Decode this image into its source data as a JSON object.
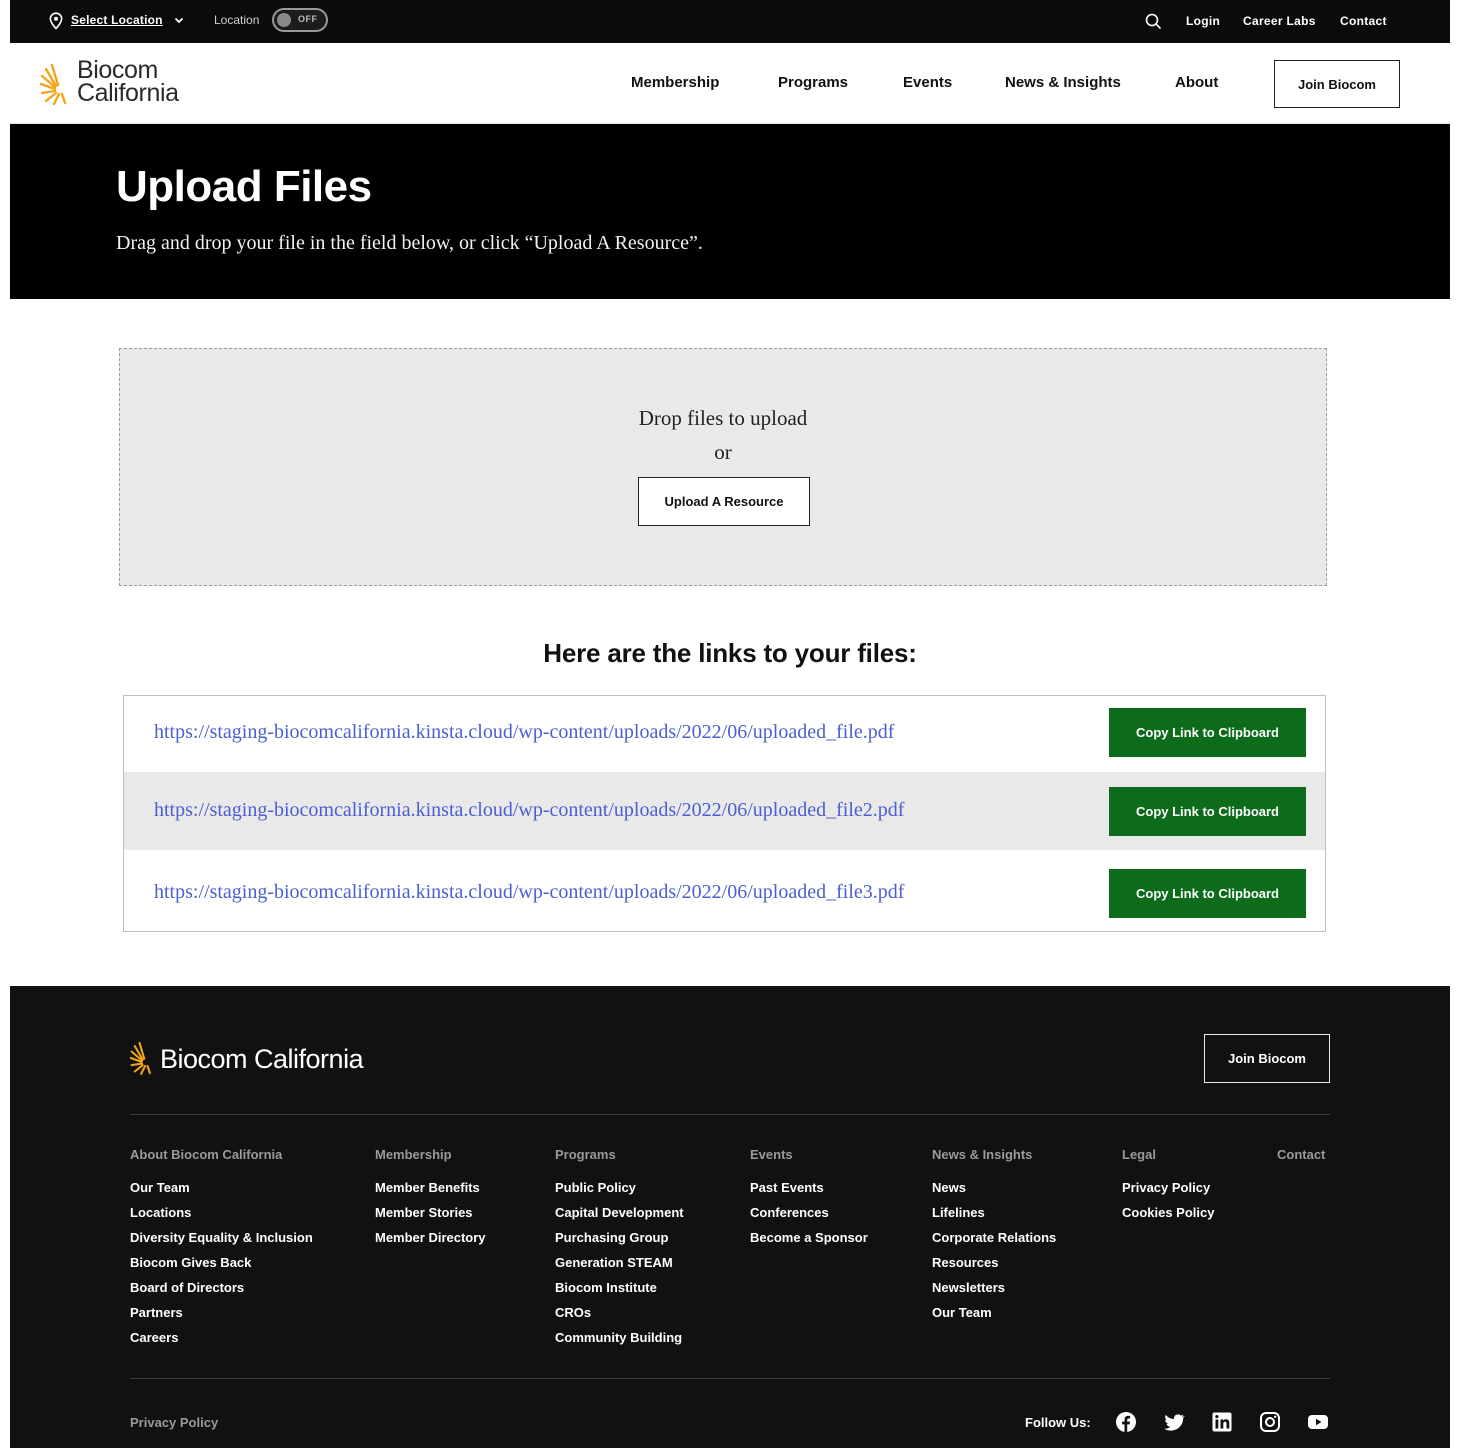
{
  "utility": {
    "select_location": "Select Location",
    "location_label": "Location",
    "toggle_state": "OFF",
    "links": [
      "Login",
      "Career Labs",
      "Contact"
    ]
  },
  "brand": {
    "line1": "Biocom",
    "line2": "California",
    "full": "Biocom California",
    "accent_color": "#f2a516"
  },
  "nav": {
    "items": [
      "Membership",
      "Programs",
      "Events",
      "News & Insights",
      "About"
    ],
    "join_label": "Join Biocom"
  },
  "hero": {
    "title": "Upload Files",
    "subtitle": "Drag and drop your file in the field below, or click “Upload A Resource”."
  },
  "dropzone": {
    "line1": "Drop files to upload",
    "line2": "or",
    "button_label": "Upload A Resource"
  },
  "links": {
    "title": "Here are the links to your files:",
    "copy_label": "Copy Link to Clipboard",
    "copy_color": "#0d6b1c",
    "files": [
      "https://staging-biocomcalifornia.kinsta.cloud/wp-content/uploads/2022/06/uploaded_file.pdf",
      "https://staging-biocomcalifornia.kinsta.cloud/wp-content/uploads/2022/06/uploaded_file2.pdf",
      "https://staging-biocomcalifornia.kinsta.cloud/wp-content/uploads/2022/06/uploaded_file3.pdf"
    ]
  },
  "footer": {
    "join_label": "Join Biocom",
    "columns": [
      {
        "heading": "About Biocom California",
        "links": [
          "Our Team",
          "Locations",
          "Diversity Equality & Inclusion",
          "Biocom Gives Back",
          "Board of Directors",
          "Partners",
          "Careers"
        ]
      },
      {
        "heading": "Membership",
        "links": [
          "Member Benefits",
          "Member Stories",
          "Member Directory"
        ]
      },
      {
        "heading": "Programs",
        "links": [
          "Public Policy",
          "Capital Development",
          "Purchasing Group",
          "Generation STEAM",
          "Biocom Institute",
          "CROs",
          "Community Building"
        ]
      },
      {
        "heading": "Events",
        "links": [
          "Past Events",
          "Conferences",
          "Become a Sponsor"
        ]
      },
      {
        "heading": "News & Insights",
        "links": [
          "News",
          "Lifelines",
          "Corporate Relations",
          "Resources",
          "Newsletters",
          "Our Team"
        ]
      },
      {
        "heading": "Legal",
        "links": [
          "Privacy Policy",
          "Cookies Policy"
        ]
      },
      {
        "heading": "Contact",
        "links": []
      }
    ],
    "bottom_privacy": "Privacy Policy",
    "follow_label": "Follow Us:",
    "social": [
      "facebook-icon",
      "twitter-icon",
      "linkedin-icon",
      "instagram-icon",
      "youtube-icon"
    ]
  }
}
